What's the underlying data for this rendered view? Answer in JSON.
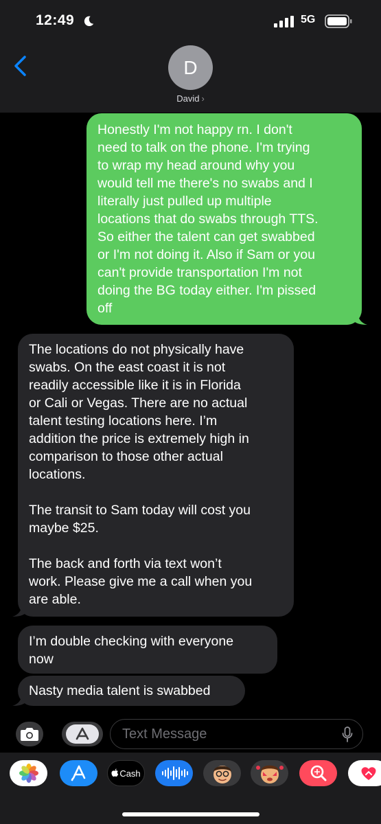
{
  "status": {
    "time": "12:49",
    "network": "5G"
  },
  "contact": {
    "initial": "D",
    "name": "David",
    "chevron": "›"
  },
  "messages": [
    {
      "direction": "sent",
      "text": "Honestly I'm not happy rn. I don't\nneed to talk on the phone. I'm trying\nto wrap my head around why you\nwould tell me there's no swabs and I\nliterally just pulled up multiple\nlocations that do swabs through TTS.\nSo either the talent can get swabbed\nor I'm not doing it. Also if Sam or you\ncan't provide transportation I'm not\ndoing the BG today either. I'm pissed\noff"
    },
    {
      "direction": "received",
      "text": "The locations do not physically have\nswabs. On the east coast it is not\nreadily accessible like it is in Florida\nor Cali or Vegas. There are no actual\ntalent testing locations here. I’m\naddition the price is extremely high in\ncomparison to those other actual\nlocations.\n\nThe transit to Sam today will cost you\nmaybe $25.\n\nThe back and forth via text won’t\nwork. Please give me a call when you\nare able."
    },
    {
      "direction": "received",
      "text": "I’m double checking with everyone\nnow"
    },
    {
      "direction": "received",
      "text": "Nasty media talent is swabbed"
    }
  ],
  "input": {
    "placeholder": "Text Message"
  },
  "app_drawer": [
    {
      "icon": "photos-icon"
    },
    {
      "icon": "app-store-icon"
    },
    {
      "icon": "apple-cash-icon",
      "label": "Cash"
    },
    {
      "icon": "audio-message-icon"
    },
    {
      "icon": "memoji-icon"
    },
    {
      "icon": "memoji-stickers-icon"
    },
    {
      "icon": "image-search-icon"
    },
    {
      "icon": "digital-touch-icon"
    }
  ],
  "colors": {
    "sent_bubble": "#5ccb5f",
    "received_bubble": "#262629",
    "header": "#1c1c1e",
    "accent": "#0a84ff"
  }
}
